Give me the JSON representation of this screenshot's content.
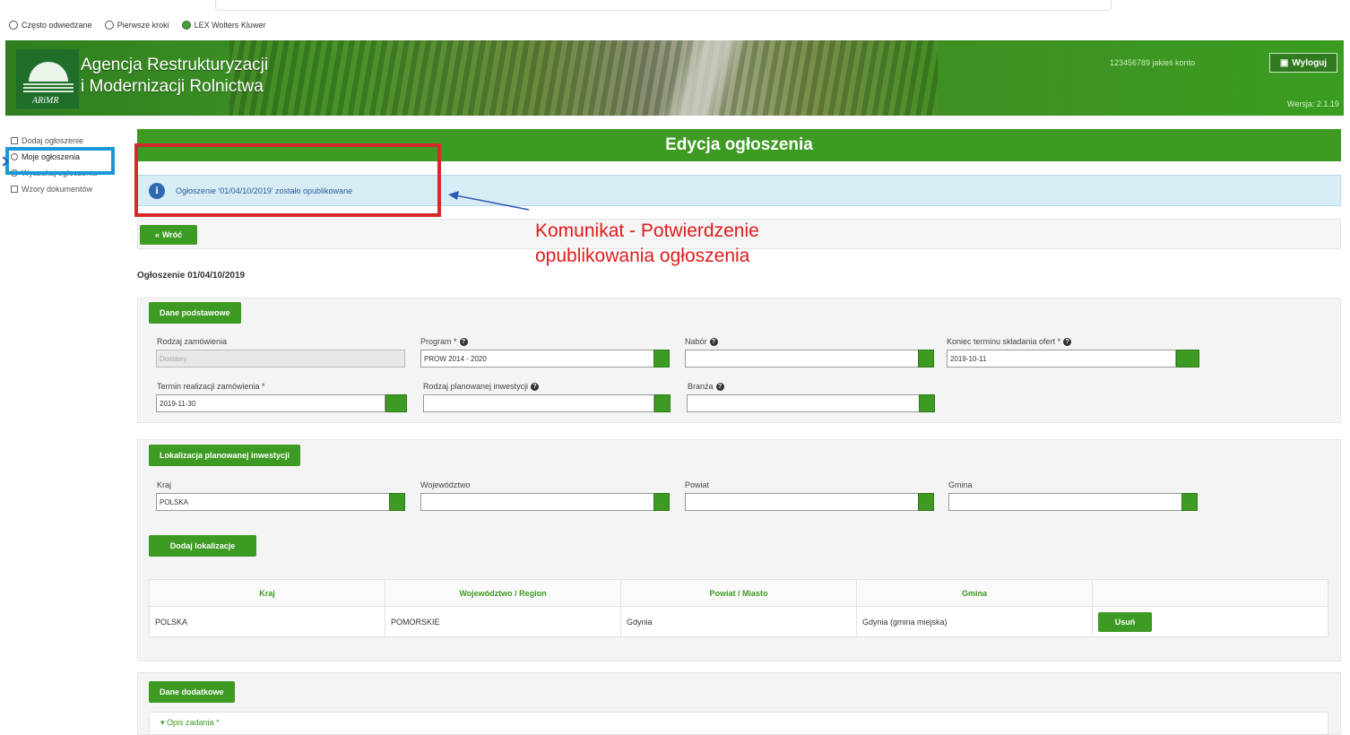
{
  "bookmarks": [
    {
      "label": "Często odwiedzane",
      "icon": "gear-icon"
    },
    {
      "label": "Pierwsze kroki",
      "icon": "globe-icon"
    },
    {
      "label": "LEX Wolters Kluwer",
      "icon": "globe-icon"
    }
  ],
  "header": {
    "agency_line1": "Agencja Restrukturyzacji",
    "agency_line2": "i Modernizacji Rolnictwa",
    "logo_text": "ARiMR",
    "user": "123456789 jakieś konto",
    "logout_label": "Wyloguj",
    "version": "Wersja: 2.1.19"
  },
  "sidebar": {
    "items": [
      {
        "label": "Dodaj ogłoszenie",
        "icon": "edit-icon"
      },
      {
        "label": "Moje ogłoszenia",
        "icon": "search-icon"
      },
      {
        "label": "Wyszukaj ogłoszenia",
        "icon": "search-icon"
      },
      {
        "label": "Wzory dokumentów",
        "icon": "folder-icon"
      }
    ]
  },
  "main": {
    "title": "Edycja ogłoszenia",
    "info_message": "Ogłoszenie '01/04/10/2019' zostało opublikowane",
    "back_label": "Wróć",
    "notice_label": "Ogłoszenie 01/04/10/2019"
  },
  "annotation": {
    "line1": "Komunikat - Potwierdzenie",
    "line2": "opublikowania ogłoszenia"
  },
  "basic": {
    "section_label": "Dane podstawowe",
    "rodzaj_label": "Rodzaj zamówienia",
    "rodzaj_value": "Dostawy",
    "program_label": "Program *",
    "program_value": "PROW 2014 - 2020",
    "nabor_label": "Nabór",
    "nabor_value": "",
    "koniec_label": "Koniec terminu składania ofert *",
    "koniec_value": "2019-10-11",
    "termin_label": "Termin realizacji zamówienia *",
    "termin_value": "2019-11-30",
    "inwestycja_label": "Rodzaj planowanej inwestycji",
    "inwestycja_value": "",
    "branza_label": "Branża",
    "branza_value": ""
  },
  "location": {
    "section_label": "Lokalizacja planowanej inwestycji",
    "kraj_label": "Kraj",
    "kraj_value": "POLSKA",
    "woj_label": "Województwo",
    "woj_value": "",
    "powiat_label": "Powiat",
    "powiat_value": "",
    "gmina_label": "Gmina",
    "gmina_value": "",
    "add_label": "Dodaj lokalizacje",
    "table_headers": [
      "Kraj",
      "Województwo / Region",
      "Powiat / Miasto",
      "Gmina",
      ""
    ],
    "table_row": {
      "kraj": "POLSKA",
      "wojewodztwo": "POMORSKIE",
      "powiat": "Gdynia",
      "gmina": "Gdynia (gmina miejska)",
      "delete_label": "Usuń"
    }
  },
  "extra": {
    "section_label": "Dane dodatkowe",
    "opis_label": "Opis zadania *"
  },
  "colors": {
    "primary_green": "#3d9a22",
    "info_bg": "#d8ecf5",
    "annotation_red": "#e01b1b",
    "highlight_blue": "#1a98d5"
  }
}
